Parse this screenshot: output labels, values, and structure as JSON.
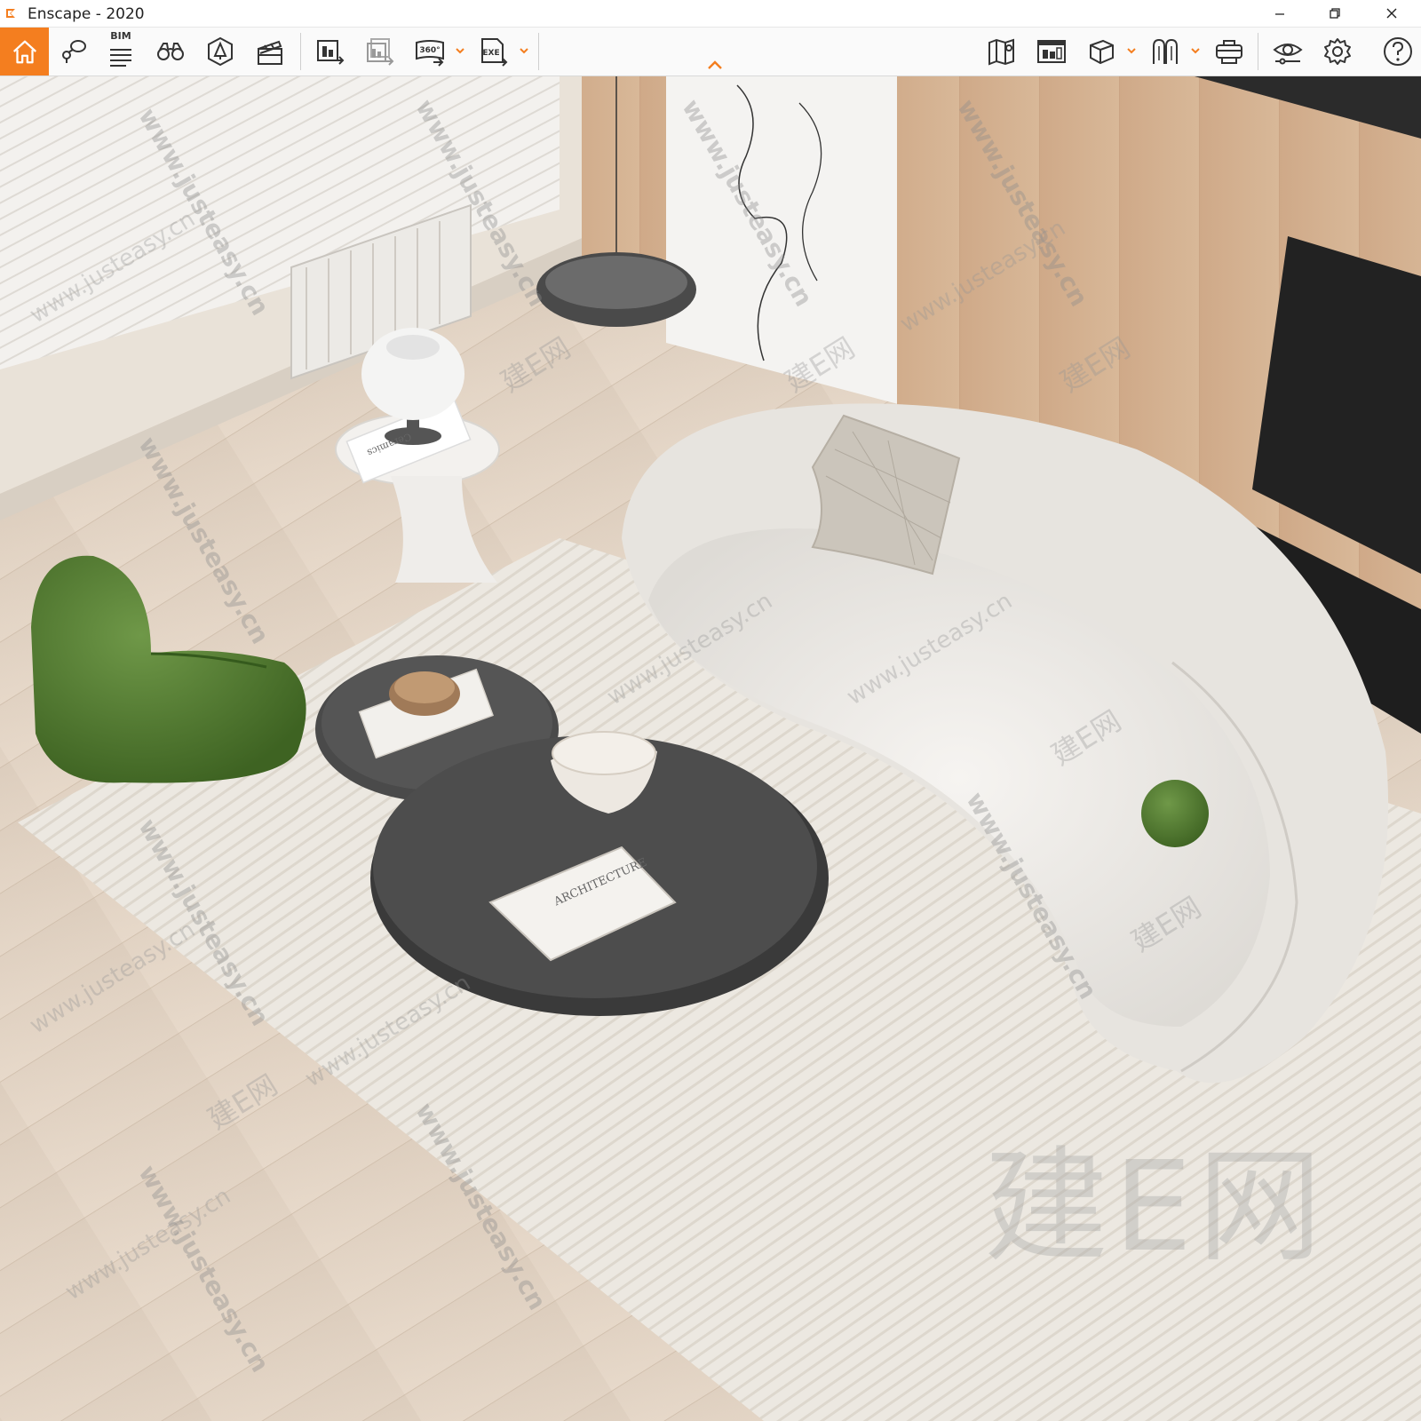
{
  "window": {
    "title": "Enscape - 2020",
    "minimize": "minimize",
    "restore": "restore",
    "close": "close"
  },
  "toolbar": {
    "accent_color": "#f47e1f",
    "bim_label": "BIM",
    "left_tools": [
      {
        "name": "home",
        "icon": "home-icon"
      },
      {
        "name": "view-management",
        "icon": "map-pin-icon"
      },
      {
        "name": "bim",
        "icon": "bim-list-icon"
      },
      {
        "name": "binoculars",
        "icon": "binoculars-icon"
      },
      {
        "name": "assets",
        "icon": "asset-library-icon"
      },
      {
        "name": "video-editor",
        "icon": "clapperboard-icon"
      },
      {
        "name": "screenshot",
        "icon": "render-image-icon"
      },
      {
        "name": "batch-render",
        "icon": "batch-render-icon"
      },
      {
        "name": "panorama",
        "icon": "panorama-360-icon"
      },
      {
        "name": "export",
        "icon": "exe-export-icon"
      }
    ],
    "right_tools": [
      {
        "name": "map",
        "icon": "map-icon"
      },
      {
        "name": "viewpoints",
        "icon": "viewpoints-icon"
      },
      {
        "name": "cube",
        "icon": "cube-icon"
      },
      {
        "name": "walk-mode",
        "icon": "walk-icon"
      },
      {
        "name": "vr",
        "icon": "vr-headset-icon"
      },
      {
        "name": "visual-settings",
        "icon": "eye-icon"
      },
      {
        "name": "settings",
        "icon": "gear-icon"
      },
      {
        "name": "help",
        "icon": "help-icon"
      }
    ],
    "panorama_label": "360°",
    "exe_label": "EXE"
  },
  "viewport": {
    "watermark_big": "建E网",
    "watermark_url": "www.justeasy.cn",
    "watermark_cn": "建E网",
    "book_title": "ARCHITECTURE",
    "side_book_text": "Ceramics"
  }
}
